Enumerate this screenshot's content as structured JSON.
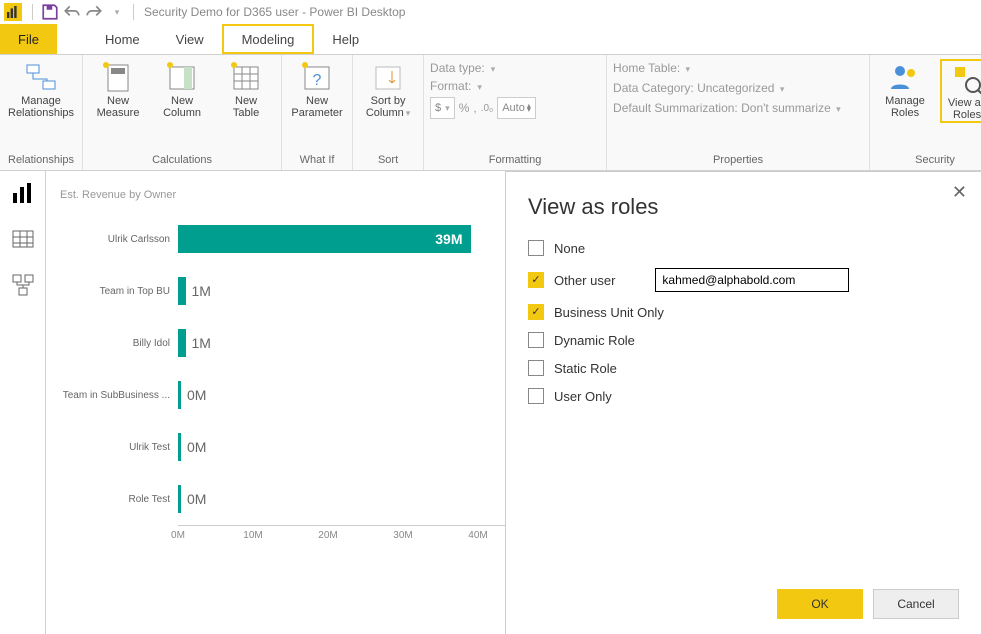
{
  "title": "Security Demo for D365 user - Power BI Desktop",
  "qat": {
    "save": "save",
    "undo": "undo",
    "redo": "redo"
  },
  "menu": {
    "file": "File",
    "home": "Home",
    "view": "View",
    "modeling": "Modeling",
    "help": "Help",
    "active": "Modeling"
  },
  "ribbon": {
    "relationships": {
      "label": "Relationships",
      "manage": "Manage\nRelationships"
    },
    "calculations": {
      "label": "Calculations",
      "newMeasure": "New\nMeasure",
      "newColumn": "New\nColumn",
      "newTable": "New\nTable"
    },
    "whatif": {
      "label": "What If",
      "newParam": "New\nParameter"
    },
    "sort": {
      "label": "Sort",
      "sortBy": "Sort by\nColumn"
    },
    "formatting": {
      "label": "Formatting",
      "dataType": "Data type:",
      "format": "Format:",
      "currency": "$",
      "percent": "%",
      "comma": ",",
      "decBox": ".0₀",
      "auto": "Auto"
    },
    "properties": {
      "label": "Properties",
      "homeTable": "Home Table:",
      "dataCat": "Data Category: Uncategorized",
      "defSum": "Default Summarization: Don't summarize"
    },
    "security": {
      "label": "Security",
      "manageRoles": "Manage\nRoles",
      "viewAs": "View as\nRoles"
    }
  },
  "chart": {
    "title": "Est. Revenue by Owner"
  },
  "chart_data": {
    "type": "bar",
    "title": "Est. Revenue by Owner",
    "categories": [
      "Ulrik Carlsson",
      "Team in Top BU",
      "Billy Idol",
      "Team in SubBusiness ...",
      "Ulrik Test",
      "Role Test"
    ],
    "values": [
      39,
      1,
      1,
      0,
      0,
      0
    ],
    "labels": [
      "39M",
      "1M",
      "1M",
      "0M",
      "0M",
      "0M"
    ],
    "axis_ticks": [
      "0M",
      "10M",
      "20M",
      "30M",
      "40M"
    ],
    "xlabel": "",
    "ylabel": "",
    "ylim": [
      0,
      40
    ]
  },
  "dialog": {
    "title": "View as roles",
    "roles": [
      {
        "label": "None",
        "checked": false
      },
      {
        "label": "Other user",
        "checked": true,
        "input": "kahmed@alphabold.com"
      },
      {
        "label": "Business Unit Only",
        "checked": true
      },
      {
        "label": "Dynamic Role",
        "checked": false
      },
      {
        "label": "Static Role",
        "checked": false
      },
      {
        "label": "User Only",
        "checked": false
      }
    ],
    "ok": "OK",
    "cancel": "Cancel"
  }
}
